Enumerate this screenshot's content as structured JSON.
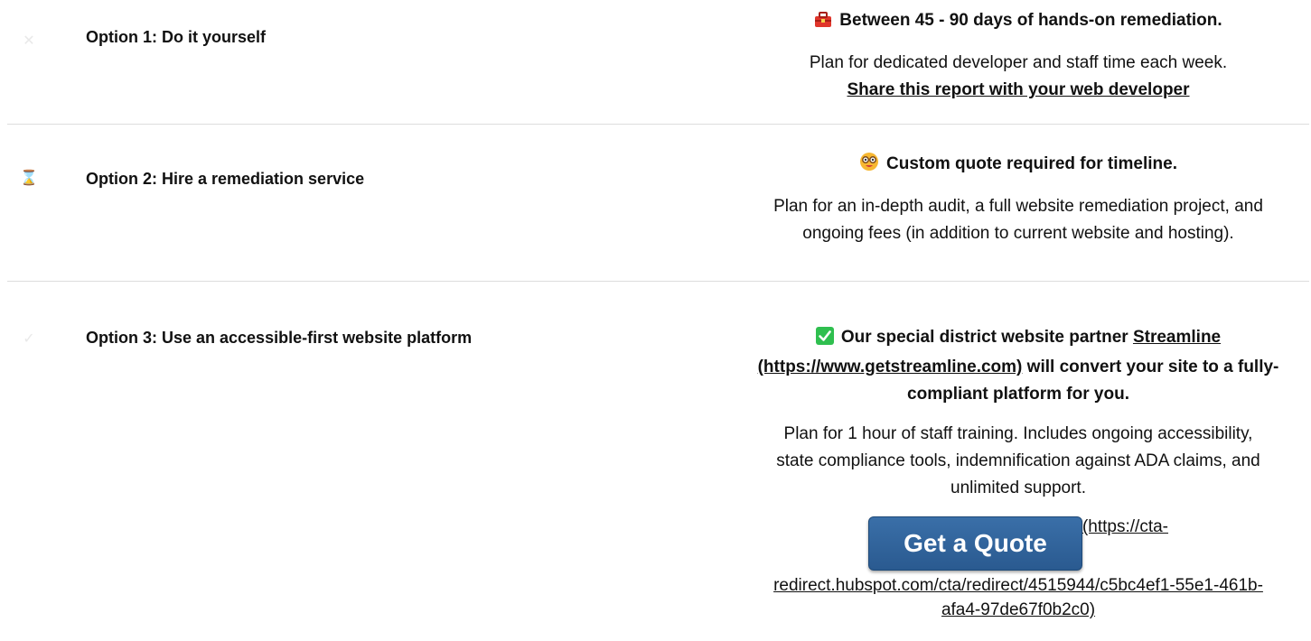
{
  "options": [
    {
      "title": "Option 1: Do it yourself",
      "icon": "tools-icon",
      "headline_icon": "toolbox-icon",
      "headline": "Between 45 - 90 days of hands-on remediation.",
      "description": "Plan for dedicated developer and staff time each week.",
      "link_label": "Share this report with your web developer"
    },
    {
      "title": "Option 2: Hire a remediation service",
      "icon": "hourglass-icon",
      "headline_icon": "nerd-face-icon",
      "headline": "Custom quote required for timeline.",
      "description_line1": "Plan for an in-depth audit, a full website remediation project, and",
      "description_line2": "ongoing fees (in addition to current website and hosting)."
    },
    {
      "title": "Option 3: Use an accessible-first website platform",
      "icon": "checkmark-icon",
      "headline_icon": "check-box-icon",
      "headline_part1": "Our special district website partner ",
      "partner_link": "Streamline",
      "partner_url_part1": "(https://www.getstreamline.com)",
      "headline_part2": " will convert your site to a fully-",
      "headline_part3": "compliant platform for you.",
      "description_line1": "Plan for 1 hour of staff training. Includes ongoing accessibility,",
      "description_line2": "state compliance tools, indemnification against ADA claims, and",
      "description_line3": "unlimited support.",
      "cta_label": "Get a Quote",
      "cta_url_part1": "(https://cta-",
      "cta_url_part2": "redirect.hubspot.com/cta/redirect/4515944/c5bc4ef1-55e1-461b-",
      "cta_url_part3": "afa4-97de67f0b2c0)"
    }
  ],
  "colors": {
    "cta_background": "#2f5f95",
    "divider": "#dddddd",
    "check_green": "#2fbf4f",
    "toolbox_red": "#e0352b"
  }
}
